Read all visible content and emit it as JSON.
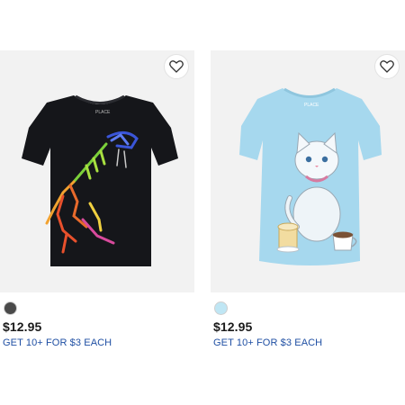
{
  "products": [
    {
      "image": "dinosaur-skeleton-graphic-tee",
      "shirt_color": "#15161a",
      "swatch_color": "#4a4a4a",
      "price": "$12.95",
      "promo": "GET 10+ FOR $3 EACH",
      "favorite_icon": "heart-outline-icon"
    },
    {
      "image": "kitten-graphic-tee",
      "shirt_color": "#a6d8ee",
      "swatch_color": "#bfe6f4",
      "price": "$12.95",
      "promo": "GET 10+ FOR $3 EACH",
      "favorite_icon": "heart-outline-icon"
    }
  ],
  "colors": {
    "promo_link": "#1f4fa3",
    "image_background": "#f2f2f2"
  }
}
